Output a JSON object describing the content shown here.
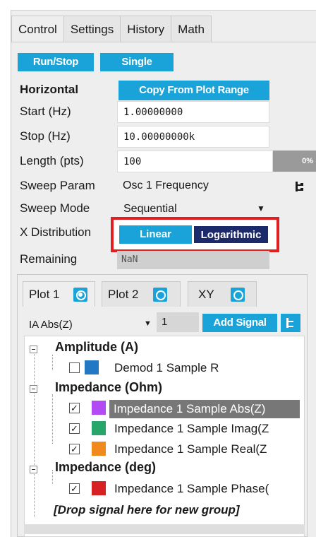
{
  "tabs": [
    {
      "label": "Control",
      "active": true
    },
    {
      "label": "Settings",
      "active": false
    },
    {
      "label": "History",
      "active": false
    },
    {
      "label": "Math",
      "active": false
    }
  ],
  "buttons": {
    "run_stop": "Run/Stop",
    "single": "Single",
    "copy_range": "Copy From Plot Range"
  },
  "horizontal": {
    "heading": "Horizontal",
    "start_label": "Start (Hz)",
    "start_value": "1.00000000",
    "stop_label": "Stop (Hz)",
    "stop_value": "10.00000000k",
    "length_label": "Length (pts)",
    "length_value": "100",
    "progress_text": "0%",
    "progress": 0,
    "sweep_param_label": "Sweep Param",
    "sweep_param_value": "Osc 1 Frequency",
    "sweep_mode_label": "Sweep Mode",
    "sweep_mode_value": "Sequential",
    "xdist_label": "X Distribution",
    "xdist_options": [
      "Linear",
      "Logarithmic"
    ],
    "xdist_selected": "Logarithmic",
    "remaining_label": "Remaining",
    "remaining_value": "NaN"
  },
  "plot_tabs": [
    {
      "label": "Plot 1",
      "active": true
    },
    {
      "label": "Plot 2",
      "active": false
    },
    {
      "label": "XY",
      "active": false
    }
  ],
  "signal_select": {
    "value": "IA Abs(Z)",
    "index": "1",
    "add_label": "Add Signal"
  },
  "tree": {
    "groups": [
      {
        "label": "Amplitude (A)",
        "items": [
          {
            "label": "Demod 1 Sample R",
            "checked": false,
            "color": "#2378c3"
          }
        ]
      },
      {
        "label": "Impedance (Ohm)",
        "items": [
          {
            "label": "Impedance 1 Sample Abs(Z)",
            "checked": true,
            "color": "#b24bf3",
            "selected": true
          },
          {
            "label": "Impedance 1 Sample Imag(Z",
            "checked": true,
            "color": "#27a56a"
          },
          {
            "label": "Impedance 1 Sample Real(Z",
            "checked": true,
            "color": "#f08a1c"
          }
        ]
      },
      {
        "label": "Impedance (deg)",
        "items": [
          {
            "label": "Impedance 1 Sample Phase(",
            "checked": true,
            "color": "#d62222"
          }
        ]
      }
    ],
    "drop_hint": "[Drop signal here for new group]"
  },
  "colors": {
    "accent": "#1aa3d8",
    "selected_dark": "#1b2a6b",
    "highlight_red": "#e02020"
  }
}
